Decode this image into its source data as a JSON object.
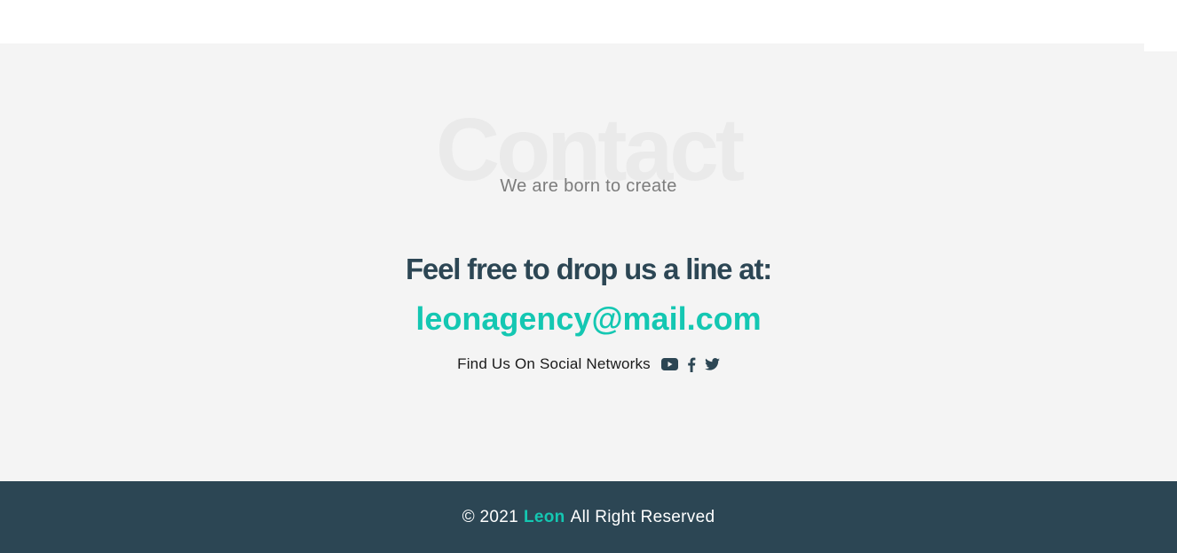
{
  "contact": {
    "background_word": "Contact",
    "subtitle": "We are born to create",
    "heading": "Feel free to drop us a line at:",
    "email": "leonagency@mail.com"
  },
  "social": {
    "label": "Find Us On Social Networks",
    "icons": [
      "youtube-icon",
      "facebook-icon",
      "twitter-icon"
    ]
  },
  "footer": {
    "copyright": "© 2021",
    "brand": "Leon",
    "rights": "All Right Reserved"
  },
  "colors": {
    "accent": "#14c7b2",
    "dark": "#2c4654",
    "section_bg": "#f4f4f4"
  }
}
